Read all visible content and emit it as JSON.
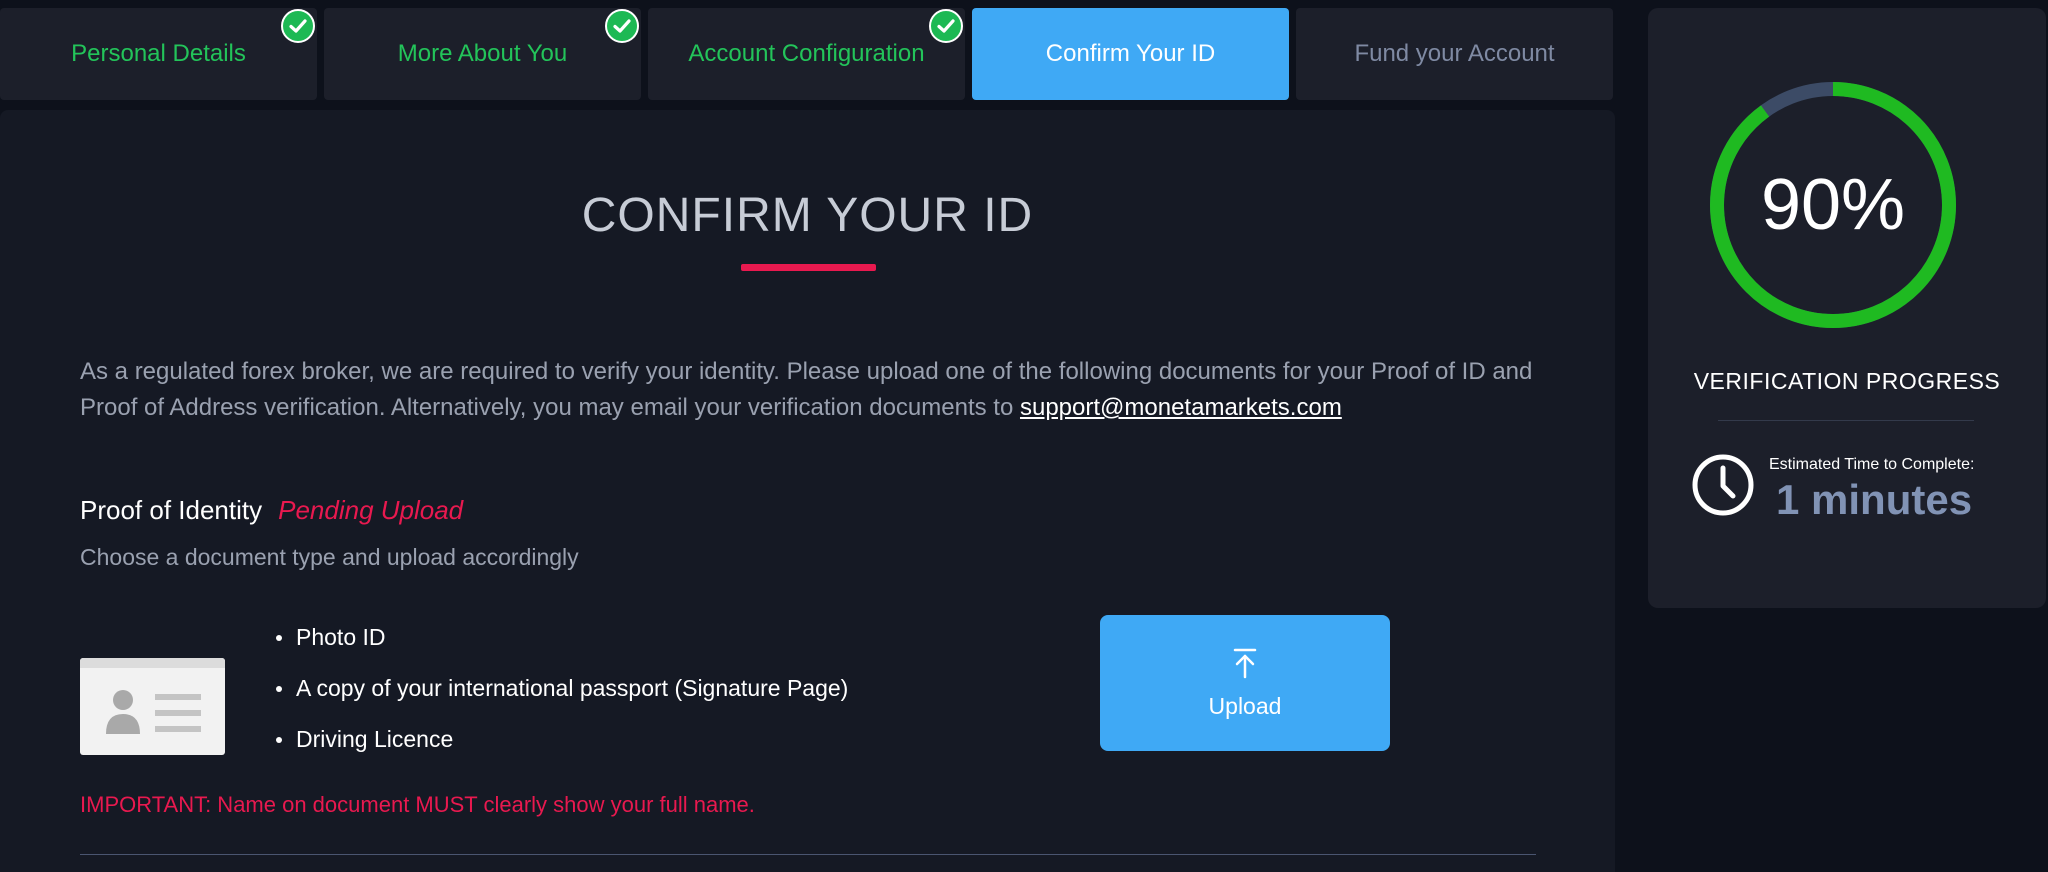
{
  "steps": [
    {
      "label": "Personal Details",
      "state": "done"
    },
    {
      "label": "More About You",
      "state": "done"
    },
    {
      "label": "Account Configuration",
      "state": "done"
    },
    {
      "label": "Confirm Your ID",
      "state": "active"
    },
    {
      "label": "Fund your Account",
      "state": "pending"
    }
  ],
  "main": {
    "title": "CONFIRM YOUR ID",
    "intro_text": "As a regulated forex broker, we are required to verify your identity. Please upload one of the following documents for your Proof of ID and Proof of Address verification. Alternatively, you may email your verification documents to ",
    "support_email": "support@monetamarkets.com",
    "proof_heading": "Proof of Identity",
    "proof_status": "Pending Upload",
    "proof_subtitle": "Choose a document type and upload accordingly",
    "documents": [
      "Photo ID",
      "A copy of your international passport (Signature Page)",
      "Driving Licence"
    ],
    "upload_label": "Upload",
    "important_note": "IMPORTANT: Name on document MUST clearly show your full name."
  },
  "progress": {
    "percent_label": "90%",
    "percent": 0.9,
    "label": "VERIFICATION PROGRESS",
    "eta_label": "Estimated Time to Complete:",
    "eta_value": "1 minutes"
  },
  "colors": {
    "accent_blue": "#3fa9f5",
    "done_green": "#23c45a",
    "ring_green": "#1fba21",
    "ring_track": "#3c4b66",
    "alert_red": "#e8194f"
  },
  "icons": {
    "step_done": "check-circle-icon",
    "id_card": "id-card-icon",
    "upload": "upload-arrow-icon",
    "clock": "clock-icon"
  }
}
